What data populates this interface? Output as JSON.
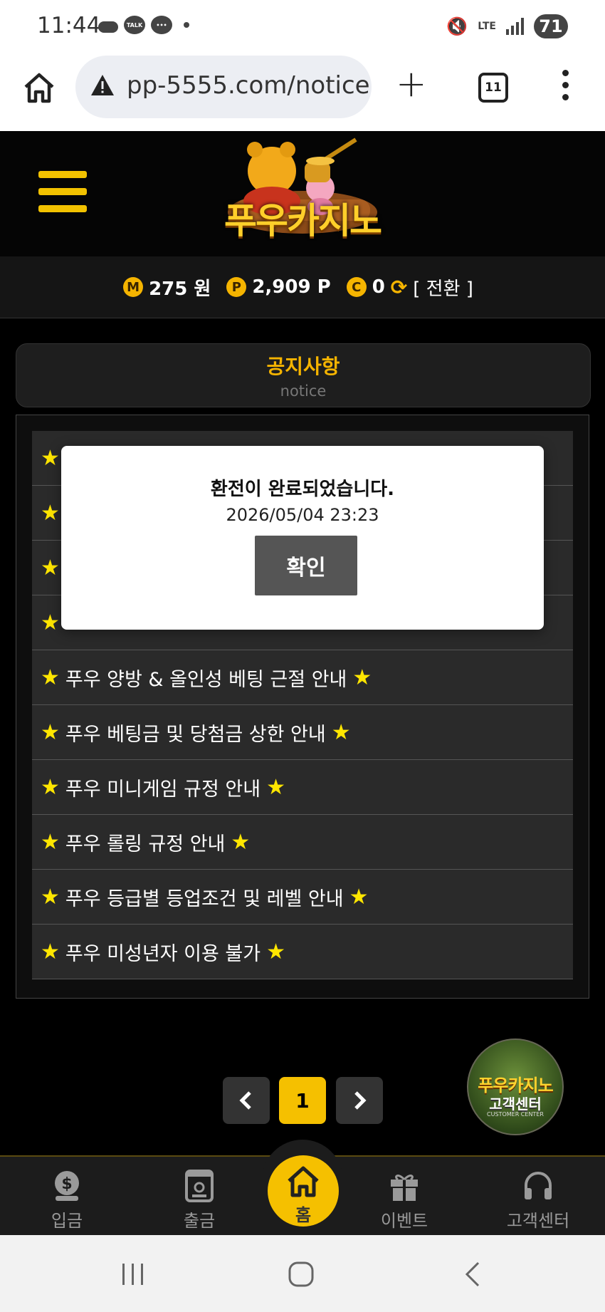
{
  "status_bar": {
    "time": "11:44",
    "talk_label": "TALK",
    "battery": "71",
    "network": "LTE"
  },
  "browser": {
    "url": "pp-5555.com/notice",
    "tab_count": "11"
  },
  "site": {
    "logo_text": "푸우카지노",
    "balance": {
      "money_badge": "M",
      "money": "275 원",
      "point_badge": "P",
      "points": "2,909 P",
      "coin_badge": "C",
      "coins": "0",
      "convert_label": "[ 전환 ]"
    }
  },
  "notice": {
    "title": "공지사항",
    "subtitle": "notice",
    "star": "★",
    "items": [
      {
        "label": ""
      },
      {
        "label": ""
      },
      {
        "label": ""
      },
      {
        "label": ""
      },
      {
        "label": "푸우 양방 & 올인성 베팅 근절 안내"
      },
      {
        "label": "푸우 베팅금 및 당첨금 상한 안내"
      },
      {
        "label": "푸우 미니게임 규정 안내"
      },
      {
        "label": "푸우 롤링 규정 안내"
      },
      {
        "label": "푸우 등급별 등업조건 및 레벨 안내"
      },
      {
        "label": "푸우 미성년자 이용 불가"
      }
    ]
  },
  "pagination": {
    "current": "1"
  },
  "customer_center_badge": {
    "line1": "푸우카지노",
    "line2": "고객센터",
    "line3": "CUSTOMER CENTER"
  },
  "bottom_nav": {
    "deposit": "입금",
    "withdraw": "출금",
    "home": "홈",
    "event": "이벤트",
    "support": "고객센터"
  },
  "modal": {
    "message": "환전이 완료되었습니다.",
    "datetime": "2026/05/04 23:23",
    "confirm_label": "확인"
  },
  "colors": {
    "accent": "#f5c000",
    "star": "#ffe600",
    "background": "#000000"
  }
}
